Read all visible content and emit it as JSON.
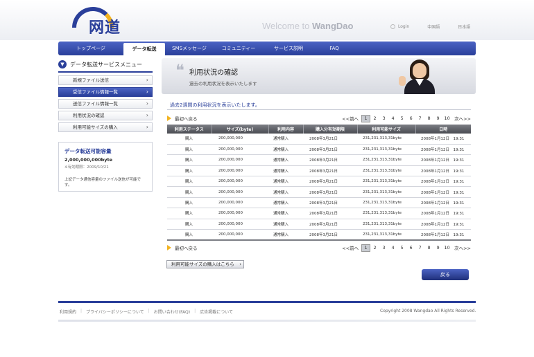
{
  "header": {
    "logo_text": "网道",
    "welcome_prefix": "Welcome to ",
    "welcome_brand": "WangDao",
    "links": [
      "Login",
      "中国語",
      "日本語"
    ]
  },
  "nav": {
    "items": [
      "トップページ",
      "データ転送",
      "SMSメッセージ",
      "コミュニティー",
      "サービス説明",
      "FAQ"
    ],
    "active_index": 1
  },
  "sidebar": {
    "title": "データ転送サービスメニュー",
    "items": [
      "新規ファイル送信",
      "受信ファイル情報一覧",
      "送信ファイル情報一覧",
      "利用状況の確認",
      "利用可能サイズの購入"
    ],
    "active_index": 1,
    "capacity": {
      "title": "データ転送可能容量",
      "value": "2,000,000,000byte",
      "expiry": "※有効期限：2009/10/21",
      "note": "上記データ通信容量のファイル送信が可能です。"
    }
  },
  "banner": {
    "title": "利用状況の確認",
    "subtitle": "過去の利用状況を表示いたします"
  },
  "intro": "過去2週間の利用状況を表示いたします。",
  "pager": {
    "back_first": "最初へ戻る",
    "prev": "<<前へ",
    "pages": [
      "1",
      "2",
      "3",
      "4",
      "5",
      "6",
      "7",
      "8",
      "9",
      "10"
    ],
    "current": "1",
    "next": "次へ>>"
  },
  "table": {
    "headers": [
      "利用ステータス",
      "サイズ(byte)",
      "利用内容",
      "購入分有効期限",
      "利用可能サイズ",
      "日時"
    ],
    "rows": [
      [
        "購入",
        "200,000,000",
        "通常購入",
        "2008年3月21日",
        "231,231,313,31byte",
        "2008年1月12日　19:31"
      ],
      [
        "購入",
        "200,000,000",
        "通常購入",
        "2008年3月21日",
        "231,231,313,31byte",
        "2008年1月12日　19:31"
      ],
      [
        "購入",
        "200,000,000",
        "通常購入",
        "2008年3月21日",
        "231,231,313,31byte",
        "2008年1月12日　19:31"
      ],
      [
        "購入",
        "200,000,000",
        "通常購入",
        "2008年3月21日",
        "231,231,313,31byte",
        "2008年1月12日　19:31"
      ],
      [
        "購入",
        "200,000,000",
        "通常購入",
        "2008年3月21日",
        "231,231,313,31byte",
        "2008年1月12日　19:31"
      ],
      [
        "購入",
        "200,000,000",
        "通常購入",
        "2008年3月21日",
        "231,231,313,31byte",
        "2008年1月12日　19:31"
      ],
      [
        "購入",
        "200,000,000",
        "通常購入",
        "2008年3月21日",
        "231,231,313,31byte",
        "2008年1月12日　19:31"
      ],
      [
        "購入",
        "200,000,000",
        "通常購入",
        "2008年3月21日",
        "231,231,313,31byte",
        "2008年1月12日　19:31"
      ],
      [
        "購入",
        "200,000,000",
        "通常購入",
        "2008年3月21日",
        "231,231,313,31byte",
        "2008年1月12日　19:31"
      ],
      [
        "購入",
        "200,000,000",
        "通常購入",
        "2008年3月21日",
        "231,231,313,31byte",
        "2008年1月12日　19:31"
      ]
    ]
  },
  "buttons": {
    "buy_label": "利用可能サイズの購入はこちら",
    "back_label": "戻る"
  },
  "footer": {
    "links": [
      "利用規約",
      "プライバシーポリシーについて",
      "お問い合わせ(FAQ)",
      "広告掲載について"
    ],
    "copyright": "Copyright 2008 Wangdao All Rights Reserved."
  },
  "colors": {
    "brand": "#2a3f9a",
    "accent": "#f2b320",
    "table_header": "#5a5c62"
  }
}
